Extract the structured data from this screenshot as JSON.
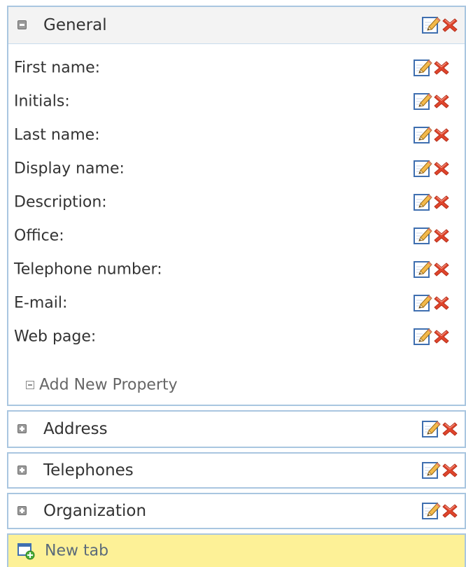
{
  "sections": {
    "general": {
      "title": "General",
      "state": "expanded",
      "properties": [
        {
          "label": "First name:"
        },
        {
          "label": "Initials:"
        },
        {
          "label": "Last name:"
        },
        {
          "label": "Display name:"
        },
        {
          "label": "Description:"
        },
        {
          "label": "Office:"
        },
        {
          "label": "Telephone number:"
        },
        {
          "label": "E-mail:"
        },
        {
          "label": "Web page:"
        }
      ],
      "add_property_label": "Add New Property"
    },
    "address": {
      "title": "Address",
      "state": "collapsed"
    },
    "telephones": {
      "title": "Telephones",
      "state": "collapsed"
    },
    "organization": {
      "title": "Organization",
      "state": "collapsed"
    }
  },
  "new_tab": {
    "label": "New tab"
  },
  "icons": {
    "edit": "pencil-edit-icon",
    "delete": "red-x-delete-icon",
    "expand": "plus-box-icon",
    "collapse": "minus-box-icon",
    "new_tab": "new-tab-icon"
  },
  "colors": {
    "panel_border": "#a9c6e0",
    "header_bg": "#f3f3f3",
    "new_tab_bg": "#fdf197",
    "delete_red": "#e0452c",
    "text": "#333333"
  }
}
